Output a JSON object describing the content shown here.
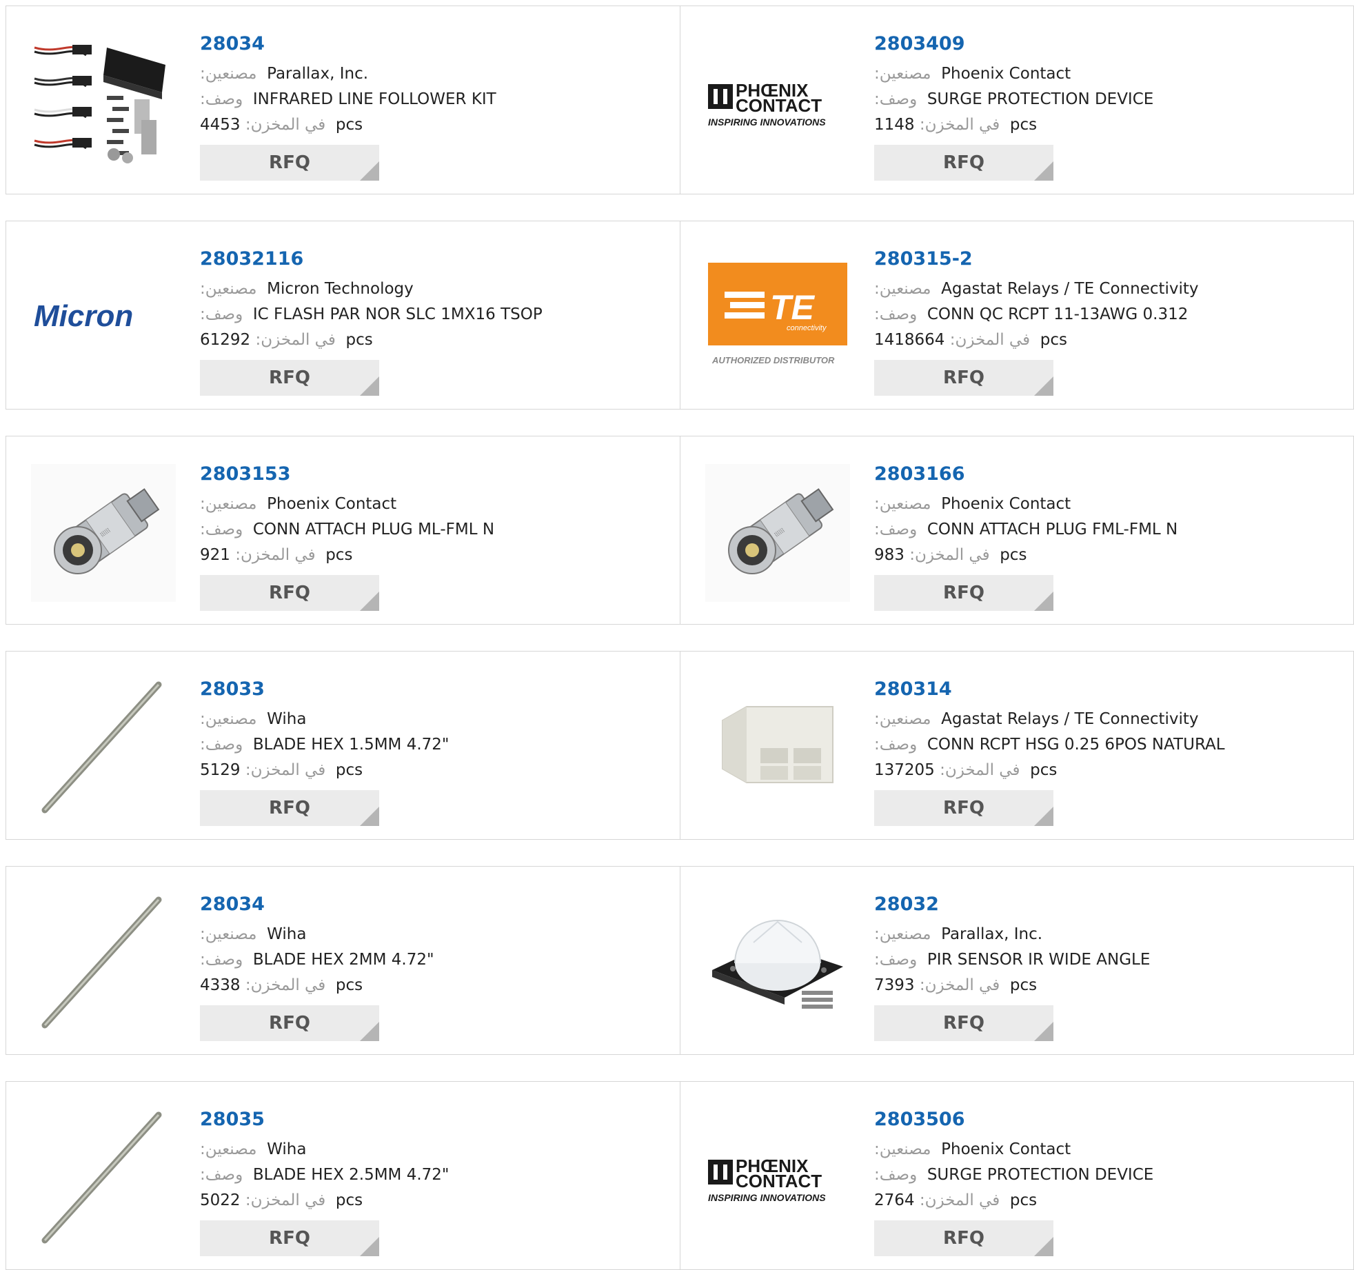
{
  "labels": {
    "manufacturer": "مصنعين:",
    "description": "وصف:",
    "stock": "في المخزن:",
    "unit": "pcs",
    "rfq": "RFQ"
  },
  "logo_text": {
    "phoenix_line1": "PHŒNIX",
    "phoenix_line2": "CONTACT",
    "phoenix_tagline": "INSPIRING INNOVATIONS",
    "micron": "Micron",
    "te": "TE",
    "te_sub": "connectivity",
    "te_caption": "AUTHORIZED DISTRIBUTOR"
  },
  "colors": {
    "link": "#1565b0",
    "te_orange": "#f28c1e"
  },
  "products": [
    {
      "part": "28034",
      "manufacturer": "Parallax, Inc.",
      "description": "INFRARED LINE FOLLOWER KIT",
      "stock": "4453",
      "image": "line-follower-kit"
    },
    {
      "part": "2803409",
      "manufacturer": "Phoenix Contact",
      "description": "SURGE PROTECTION DEVICE",
      "stock": "1148",
      "image": "phoenix-contact-logo"
    },
    {
      "part": "28032116",
      "manufacturer": "Micron Technology",
      "description": "IC FLASH PAR NOR SLC 1MX16 TSOP",
      "stock": "61292",
      "image": "micron-logo"
    },
    {
      "part": "280315-2",
      "manufacturer": "Agastat Relays / TE Connectivity",
      "description": "CONN QC RCPT 11-13AWG 0.312",
      "stock": "1418664",
      "image": "te-connectivity-logo"
    },
    {
      "part": "2803153",
      "manufacturer": "Phoenix Contact",
      "description": "CONN ATTACH PLUG ML-FML N",
      "stock": "921",
      "image": "n-connector-adapter"
    },
    {
      "part": "2803166",
      "manufacturer": "Phoenix Contact",
      "description": "CONN ATTACH PLUG FML-FML N",
      "stock": "983",
      "image": "n-connector-adapter"
    },
    {
      "part": "28033",
      "manufacturer": "Wiha",
      "description": "BLADE HEX 1.5MM 4.72\"",
      "stock": "5129",
      "image": "hex-blade"
    },
    {
      "part": "280314",
      "manufacturer": "Agastat Relays / TE Connectivity",
      "description": "CONN RCPT HSG 0.25 6POS NATURAL",
      "stock": "137205",
      "image": "connector-housing"
    },
    {
      "part": "28034",
      "manufacturer": "Wiha",
      "description": "BLADE HEX 2MM 4.72\"",
      "stock": "4338",
      "image": "hex-blade"
    },
    {
      "part": "28032",
      "manufacturer": "Parallax, Inc.",
      "description": "PIR SENSOR IR WIDE ANGLE",
      "stock": "7393",
      "image": "pir-sensor"
    },
    {
      "part": "28035",
      "manufacturer": "Wiha",
      "description": "BLADE HEX 2.5MM 4.72\"",
      "stock": "5022",
      "image": "hex-blade"
    },
    {
      "part": "2803506",
      "manufacturer": "Phoenix Contact",
      "description": "SURGE PROTECTION DEVICE",
      "stock": "2764",
      "image": "phoenix-contact-logo"
    }
  ]
}
